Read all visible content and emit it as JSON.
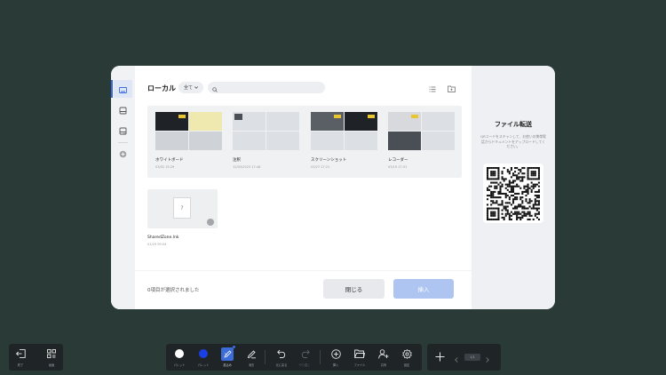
{
  "dialog": {
    "title": "ローカル",
    "filter_label": "全て",
    "search_placeholder": "",
    "folders": [
      {
        "name": "ホワイトボード",
        "date": "03/02 15:29"
      },
      {
        "name": "注釈",
        "date": "12/03/2023 17:48"
      },
      {
        "name": "スクリーンショット",
        "date": "03/27 17:21"
      },
      {
        "name": "レコーダー",
        "date": "03/19 17:31"
      }
    ],
    "files": [
      {
        "name": "SharedZone.lnk",
        "date": "01/29 09:04"
      }
    ],
    "status_text": "0項目が選択されました",
    "close_label": "閉じる",
    "insert_label": "挿入"
  },
  "side_panel": {
    "title": "ファイル転送",
    "description": "QRコードをスキャンして、お使いの携帯電話からドキュメントをアップロードしてください。"
  },
  "toolbar_left": [
    {
      "icon": "exit-icon",
      "label": "終了"
    },
    {
      "icon": "windows-icon",
      "label": "画面"
    }
  ],
  "toolbar_main": [
    {
      "icon": "white-swatch-icon",
      "label": "パレット"
    },
    {
      "icon": "blue-swatch-icon",
      "label": "パレット"
    },
    {
      "icon": "pen-icon",
      "label": "書込み"
    },
    {
      "icon": "eraser-icon",
      "label": "消去"
    },
    {
      "icon": "undo-icon",
      "label": "元に戻る"
    },
    {
      "icon": "redo-icon",
      "label": "やり直し"
    },
    {
      "icon": "insert-icon",
      "label": "挿入"
    },
    {
      "icon": "file-icon",
      "label": "ファイル"
    },
    {
      "icon": "share-icon",
      "label": "共有"
    },
    {
      "icon": "settings-icon",
      "label": "設定"
    }
  ],
  "toolbar_page": {
    "page_indicator": "1/1"
  },
  "colors": {
    "accent": "#3c6cd8",
    "background": "#2a3a36",
    "swatch_blue": "#1b3fe3"
  }
}
